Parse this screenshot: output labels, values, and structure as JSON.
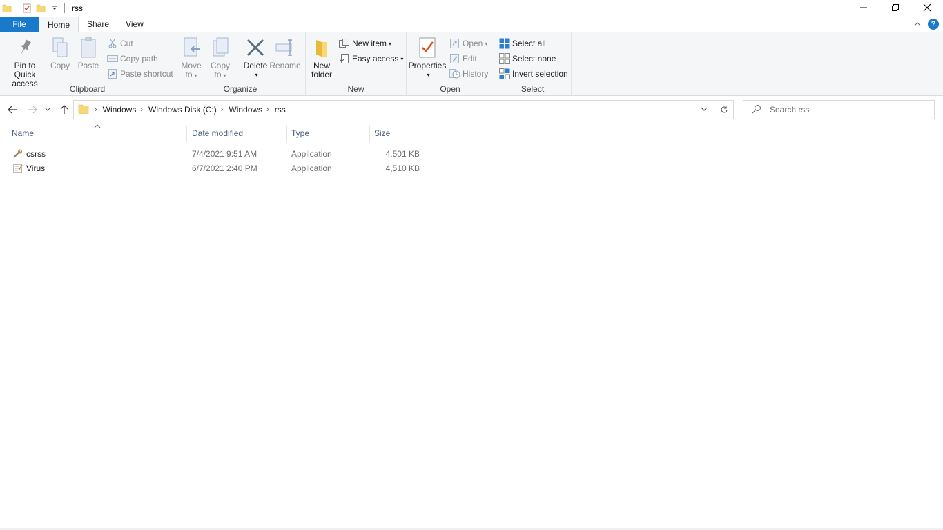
{
  "window": {
    "title": "rss"
  },
  "tabs": {
    "file": "File",
    "home": "Home",
    "share": "Share",
    "view": "View"
  },
  "ribbon": {
    "clipboard": {
      "label": "Clipboard",
      "pin_l1": "Pin to Quick",
      "pin_l2": "access",
      "copy": "Copy",
      "paste": "Paste",
      "cut": "Cut",
      "copy_path": "Copy path",
      "paste_shortcut": "Paste shortcut"
    },
    "organize": {
      "label": "Organize",
      "move_l1": "Move",
      "move_l2": "to",
      "copy_l1": "Copy",
      "copy_l2": "to",
      "delete": "Delete",
      "rename": "Rename"
    },
    "new": {
      "label": "New",
      "folder_l1": "New",
      "folder_l2": "folder",
      "new_item": "New item",
      "easy_access": "Easy access"
    },
    "open": {
      "label": "Open",
      "properties": "Properties",
      "open": "Open",
      "edit": "Edit",
      "history": "History"
    },
    "select": {
      "label": "Select",
      "select_all": "Select all",
      "select_none": "Select none",
      "invert": "Invert selection"
    }
  },
  "address": {
    "crumbs": [
      "Windows",
      "Windows Disk (C:)",
      "Windows",
      "rss"
    ]
  },
  "search": {
    "placeholder": "Search rss"
  },
  "columns": {
    "name": "Name",
    "date": "Date modified",
    "type": "Type",
    "size": "Size"
  },
  "files": [
    {
      "name": "csrss",
      "date": "7/4/2021 9:51 AM",
      "type": "Application",
      "size": "4,501 KB",
      "icon": "wrench-app-icon"
    },
    {
      "name": "Virus",
      "date": "6/7/2021 2:40 PM",
      "type": "Application",
      "size": "4,510 KB",
      "icon": "notepad-app-icon"
    }
  ],
  "colors": {
    "accent": "#1979ca",
    "folder": "#f8d775",
    "header_text": "#4c607a"
  }
}
